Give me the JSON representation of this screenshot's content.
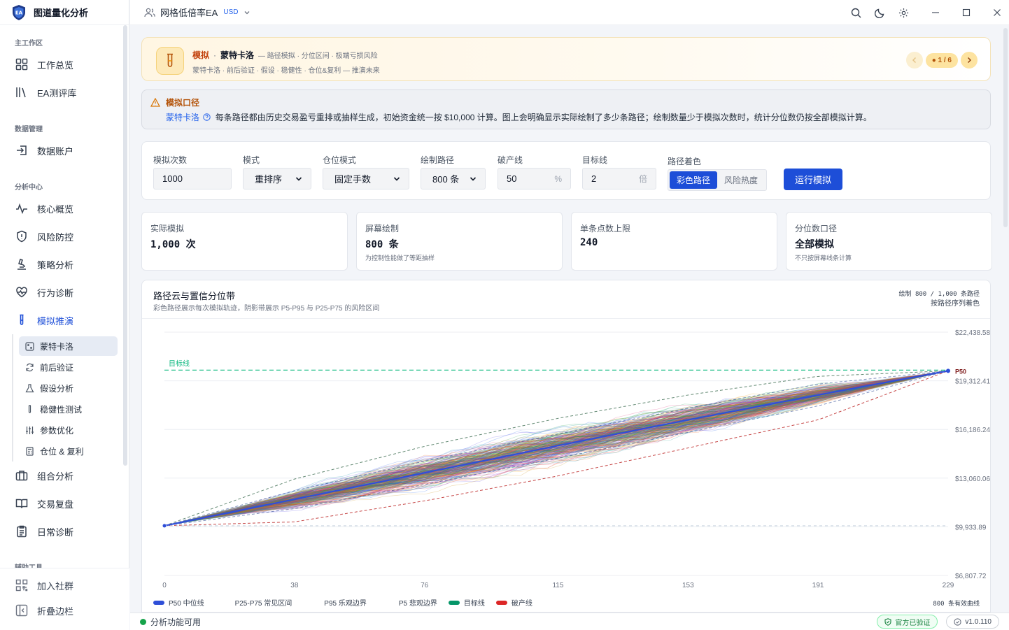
{
  "app": {
    "brand": "图道量化分析"
  },
  "topbar": {
    "account_name": "网格低倍率EA",
    "currency": "USD"
  },
  "sidebar": {
    "sections": {
      "main": "主工作区",
      "data": "数据管理",
      "analysis": "分析中心",
      "tools": "辅助工具"
    },
    "main_items": [
      {
        "label": "工作总览",
        "icon": "grid-icon"
      },
      {
        "label": "EA测评库",
        "icon": "library-icon"
      }
    ],
    "data_items": [
      {
        "label": "数据账户",
        "icon": "import-icon"
      }
    ],
    "analysis_items": [
      {
        "label": "核心概览",
        "icon": "pulse-icon"
      },
      {
        "label": "风险防控",
        "icon": "shield-icon"
      },
      {
        "label": "策略分析",
        "icon": "microscope-icon"
      },
      {
        "label": "行为诊断",
        "icon": "heart-pulse-icon"
      },
      {
        "label": "模拟推演",
        "icon": "test-tube-icon"
      }
    ],
    "sim_subitems": [
      {
        "label": "蒙特卡洛",
        "icon": "dice-icon"
      },
      {
        "label": "前后验证",
        "icon": "refresh-icon"
      },
      {
        "label": "假设分析",
        "icon": "flask-icon"
      },
      {
        "label": "稳健性测试",
        "icon": "tube-icon"
      },
      {
        "label": "参数优化",
        "icon": "sliders-icon"
      },
      {
        "label": "仓位 & 复利",
        "icon": "calculator-icon"
      }
    ],
    "more_items": [
      {
        "label": "组合分析",
        "icon": "briefcase-icon"
      },
      {
        "label": "交易复盘",
        "icon": "book-icon"
      },
      {
        "label": "日常诊断",
        "icon": "clipboard-icon"
      }
    ],
    "bottom_items": [
      {
        "label": "加入社群",
        "icon": "qr-icon"
      },
      {
        "label": "折叠边栏",
        "icon": "collapse-icon"
      }
    ]
  },
  "banner": {
    "kicker": "模拟",
    "title": "蒙特卡洛",
    "tagline": "— 路径模拟 · 分位区间 · 极端亏损风险",
    "desc": "蒙特卡洛 · 前后验证 · 假设 · 稳健性 · 仓位&复利 — 推演未来",
    "page": "1 / 6"
  },
  "notice": {
    "title": "模拟口径",
    "link": "蒙特卡洛",
    "text": "每条路径都由历史交易盈亏重排或抽样生成，初始资金统一按 $10,000 计算。图上会明确显示实际绘制了多少条路径；绘制数量少于模拟次数时，统计分位数仍按全部模拟计算。"
  },
  "params": {
    "sims": {
      "label": "模拟次数",
      "value": "1000"
    },
    "mode": {
      "label": "模式",
      "value": "重排序"
    },
    "position": {
      "label": "仓位模式",
      "value": "固定手数"
    },
    "paths": {
      "label": "绘制路径",
      "value": "800 条"
    },
    "ruin": {
      "label": "破产线",
      "value": "50",
      "suffix": "%"
    },
    "target": {
      "label": "目标线",
      "value": "2",
      "suffix": "倍"
    },
    "coloring": {
      "label": "路径着色",
      "options": [
        "彩色路径",
        "风险热度"
      ],
      "selected": "彩色路径"
    },
    "run_label": "运行模拟"
  },
  "stats": [
    {
      "label": "实际模拟",
      "value": "1,000 次",
      "note": ""
    },
    {
      "label": "屏幕绘制",
      "value": "800 条",
      "note": "为控制性能做了等距抽样"
    },
    {
      "label": "单条点数上限",
      "value": "240",
      "note": ""
    },
    {
      "label": "分位数口径",
      "value": "全部模拟",
      "note": "不只按屏幕线条计算"
    }
  ],
  "chart": {
    "title": "路径云与置信分位带",
    "subtitle": "彩色路径展示每次模拟轨迹，阴影带展示 P5-P95 与 P25-P75 的风险区间",
    "top_right_line1": "绘制 800 / 1,000 条路径",
    "top_right_line2": "按路径序列着色",
    "legend": [
      {
        "label": "P50 中位线",
        "color": "#2f4fd8"
      },
      {
        "label": "P25-P75 常见区间",
        "color": ""
      },
      {
        "label": "P95 乐观边界",
        "color": ""
      },
      {
        "label": "P5 悲观边界",
        "color": ""
      },
      {
        "label": "目标线",
        "color": "#059669"
      },
      {
        "label": "破产线",
        "color": "#dc2626"
      }
    ],
    "legend_right": "800 条有效曲线",
    "target_label": "目标线",
    "p50_label": "P50"
  },
  "chart_data": {
    "type": "line",
    "x_ticks": [
      "0",
      "38",
      "76",
      "115",
      "153",
      "191",
      "229"
    ],
    "xlim": [
      0,
      229
    ],
    "y_ticks": [
      "$6,807.72",
      "$9,933.89",
      "$13,060.06",
      "$16,186.24",
      "$19,312.41",
      "$22,438.58"
    ],
    "ylim": [
      6807.72,
      22438.58
    ],
    "initial_capital": 10000,
    "target_value": 20000,
    "ruin_value": 5000,
    "grid": true,
    "bands": {
      "x": [
        0,
        38,
        76,
        115,
        153,
        191,
        229
      ],
      "p50": [
        10000,
        11700,
        13400,
        15150,
        16800,
        18400,
        19950
      ],
      "p25": [
        10000,
        11100,
        12650,
        14350,
        16000,
        17700,
        19950
      ],
      "p75": [
        10000,
        12250,
        14150,
        15900,
        17550,
        19100,
        19950
      ],
      "p5": [
        10000,
        10250,
        11600,
        13200,
        15000,
        16800,
        19950
      ],
      "p95": [
        10000,
        13000,
        15100,
        16900,
        18400,
        19600,
        19950
      ]
    },
    "drawn_paths": 800,
    "total_simulations": 1000
  },
  "status": {
    "left": "分析功能可用",
    "verified": "官方已验证",
    "version": "v1.0.110"
  }
}
